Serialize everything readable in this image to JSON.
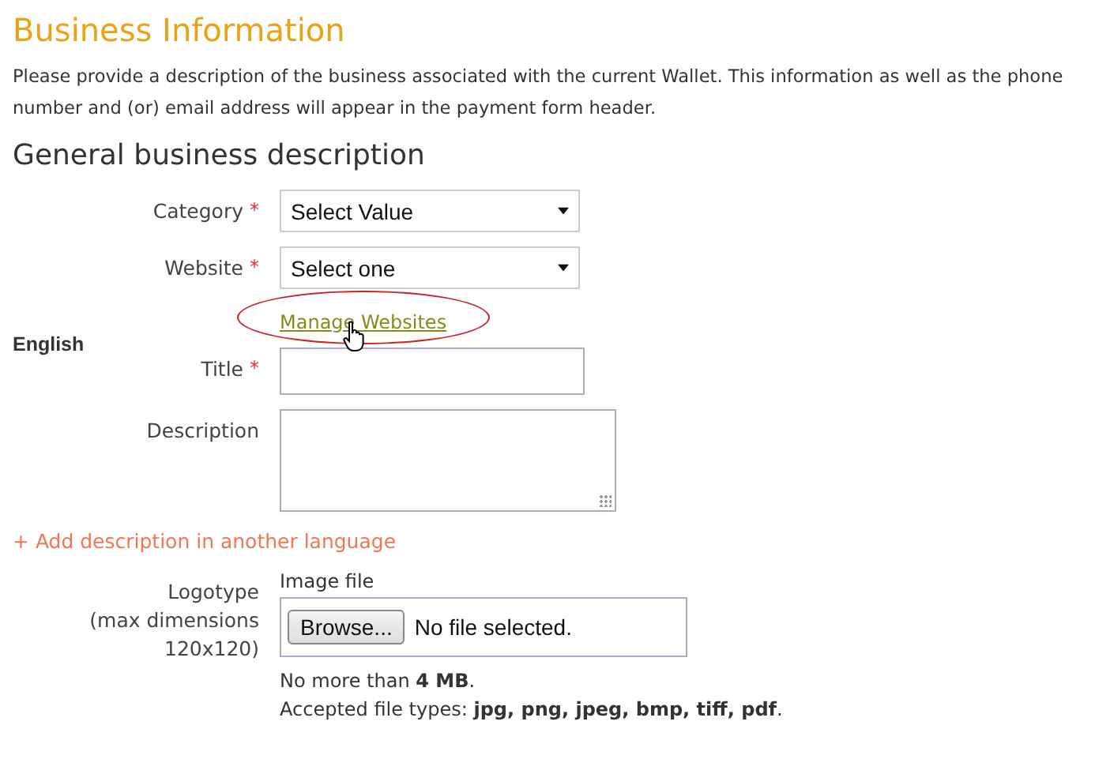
{
  "title": "Business Information",
  "intro": "Please provide a description of the business associated with the current Wallet. This information as well as the phone number and (or) email address will appear in the payment form header.",
  "section_title": "General business description",
  "rows": [
    {
      "kind": "select",
      "label": "Category",
      "mark": "*",
      "value": "Select Value"
    },
    {
      "kind": "select",
      "label": "Website",
      "mark": "*",
      "value": "Select one"
    },
    {
      "kind": "link",
      "text": "Manage Websites",
      "highlighted": true
    },
    {
      "kind": "language",
      "text": "English"
    },
    {
      "kind": "text",
      "label": "Title",
      "mark": "*"
    },
    {
      "kind": "textarea",
      "label": "Description"
    }
  ],
  "add_link": "+ Add description in another language",
  "logotype": {
    "label": "Logotype",
    "hint": "(max dimensions 120x120)",
    "field_label": "Image file",
    "button": "Browse...",
    "status": "No file selected.",
    "notes": [
      "No more than **4 MB**.",
      "Accepted file types: **jpg, png, jpeg, bmp, tiff, pdf**."
    ]
  }
}
